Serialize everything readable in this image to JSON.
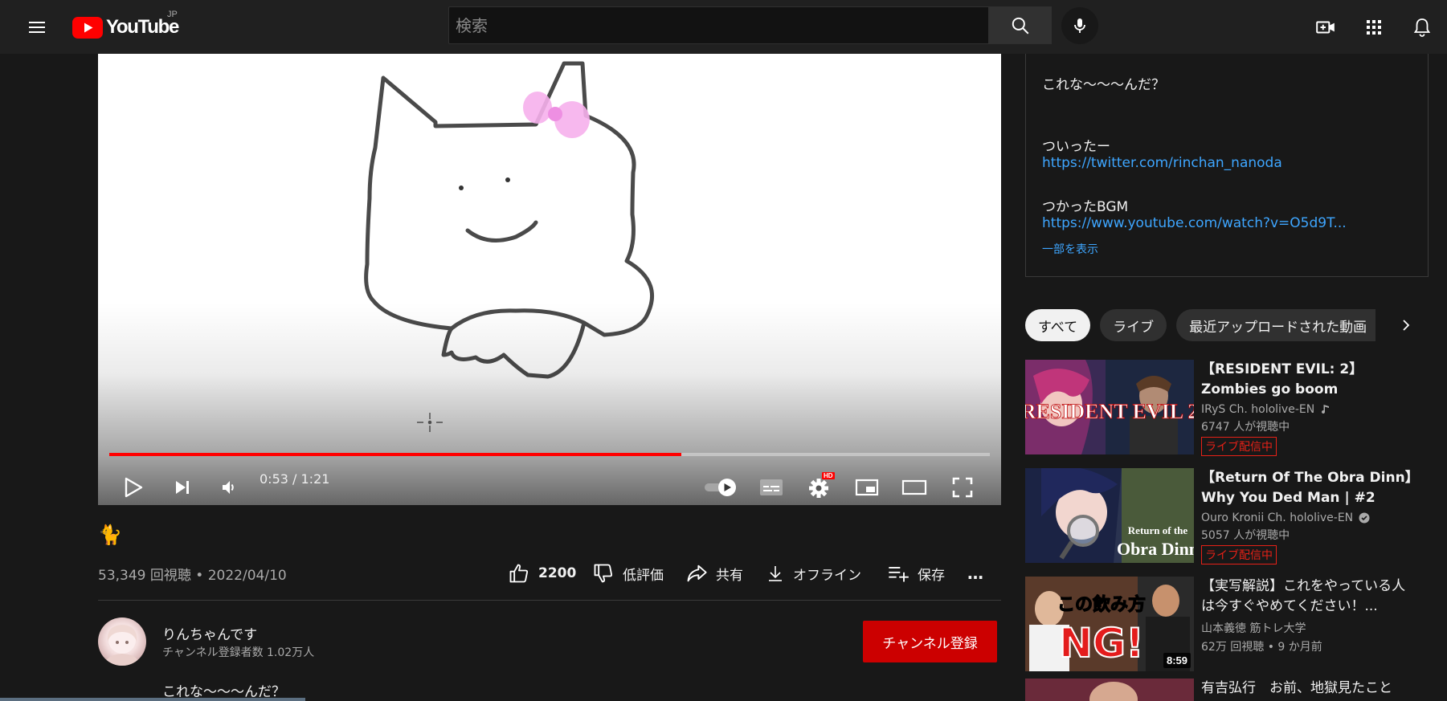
{
  "header": {
    "logo_text": "YouTube",
    "region": "JP",
    "search_placeholder": "検索"
  },
  "player": {
    "time_current": "0:53",
    "time_separator": " / ",
    "time_total": "1:21",
    "progress_fraction": 0.65,
    "hd_badge": "HD",
    "autoplay": "on"
  },
  "video": {
    "title": "🐈",
    "views": "53,349 回視聴",
    "date_separator": " • ",
    "date": "2022/04/10",
    "like_count": "2200",
    "dislike_label": "低評価",
    "share_label": "共有",
    "offline_label": "オフライン",
    "save_label": "保存",
    "more_label": "…"
  },
  "channel": {
    "name": "りんちゃんです",
    "subscribers": "チャンネル登録者数 1.02万人",
    "subscribe_label": "チャンネル登録"
  },
  "description_first_line": "これな～～～んだ？",
  "description_panel": {
    "line1": "これな～～～んだ？",
    "twitter_heading": "ついったー",
    "twitter_link": "https://twitter.com/rinchan_nanoda",
    "bgm_heading": "つかったBGM",
    "bgm_link": "https://www.youtube.com/watch?v=O5d9T...",
    "show_less": "一部を表示"
  },
  "chips": [
    {
      "label": "すべて",
      "active": true
    },
    {
      "label": "ライブ",
      "active": false
    },
    {
      "label": "最近アップロードされた動画",
      "active": false
    }
  ],
  "recommendations": [
    {
      "title": "【RESIDENT EVIL: 2】Zombies go boom",
      "channel": "IRyS Ch. hololive-EN",
      "channel_badge": "music-note-icon",
      "meta": "6747 人が視聴中",
      "badge": "ライブ配信中",
      "thumb_text": "RESIDENT EVIL 2"
    },
    {
      "title": "【Return Of The Obra Dinn】Why You Ded Man | #2",
      "channel": "Ouro Kronii Ch. hololive-EN",
      "channel_badge": "verified-icon",
      "meta": "5057 人が視聴中",
      "badge": "ライブ配信中",
      "thumb_text_1": "Return of the",
      "thumb_text_2": "Obra Dinn"
    },
    {
      "title": "【実写解説】これをやっている人は今すぐやめてください！...",
      "channel": "山本義徳 筋トレ大学",
      "meta": "62万 回視聴 • 9 か月前",
      "duration": "8:59",
      "thumb_text_1": "この飲み方",
      "thumb_text_2": "NG!"
    },
    {
      "title": "有吉弘行　お前、地獄見たこと"
    }
  ],
  "colors": {
    "background": "#181818",
    "header": "#202020",
    "accent_red": "#ff0000",
    "subscribe_red": "#cc0000",
    "link_blue": "#3ea6ff"
  }
}
